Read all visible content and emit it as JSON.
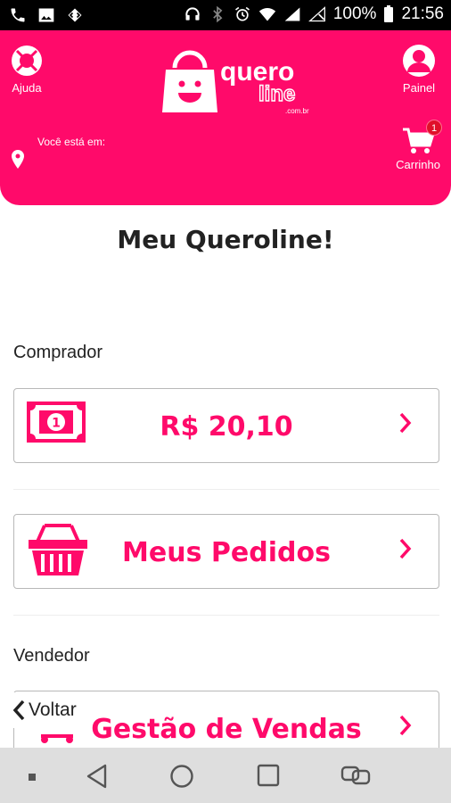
{
  "status_bar": {
    "battery": "100%",
    "time": "21:56",
    "left_icons": [
      "phone-icon",
      "image-icon",
      "code-icon"
    ],
    "right_icons": [
      "headset-icon",
      "bluetooth-icon",
      "alarm-icon",
      "wifi-icon",
      "signal-icon",
      "no-signal-icon",
      "battery-icon"
    ]
  },
  "header": {
    "help_label": "Ajuda",
    "panel_label": "Painel",
    "cart_label": "Carrinho",
    "cart_count": "1",
    "location_label": "Você está em:",
    "logo": {
      "word1": "quero",
      "word2": "line",
      "word3": ".com.br"
    },
    "color": "#ff0a6a"
  },
  "main": {
    "title": "Meu Queroline!",
    "buyer_section": "Comprador",
    "balance": "R$ 20,10",
    "orders_label": "Meus Pedidos",
    "seller_section": "Vendedor",
    "sales_label": "Gestão de Vendas",
    "back_label": "Voltar"
  },
  "nav_bar": {
    "icons": [
      "dot-icon",
      "back-triangle-icon",
      "home-circle-icon",
      "recents-square-icon",
      "link-icon"
    ]
  }
}
